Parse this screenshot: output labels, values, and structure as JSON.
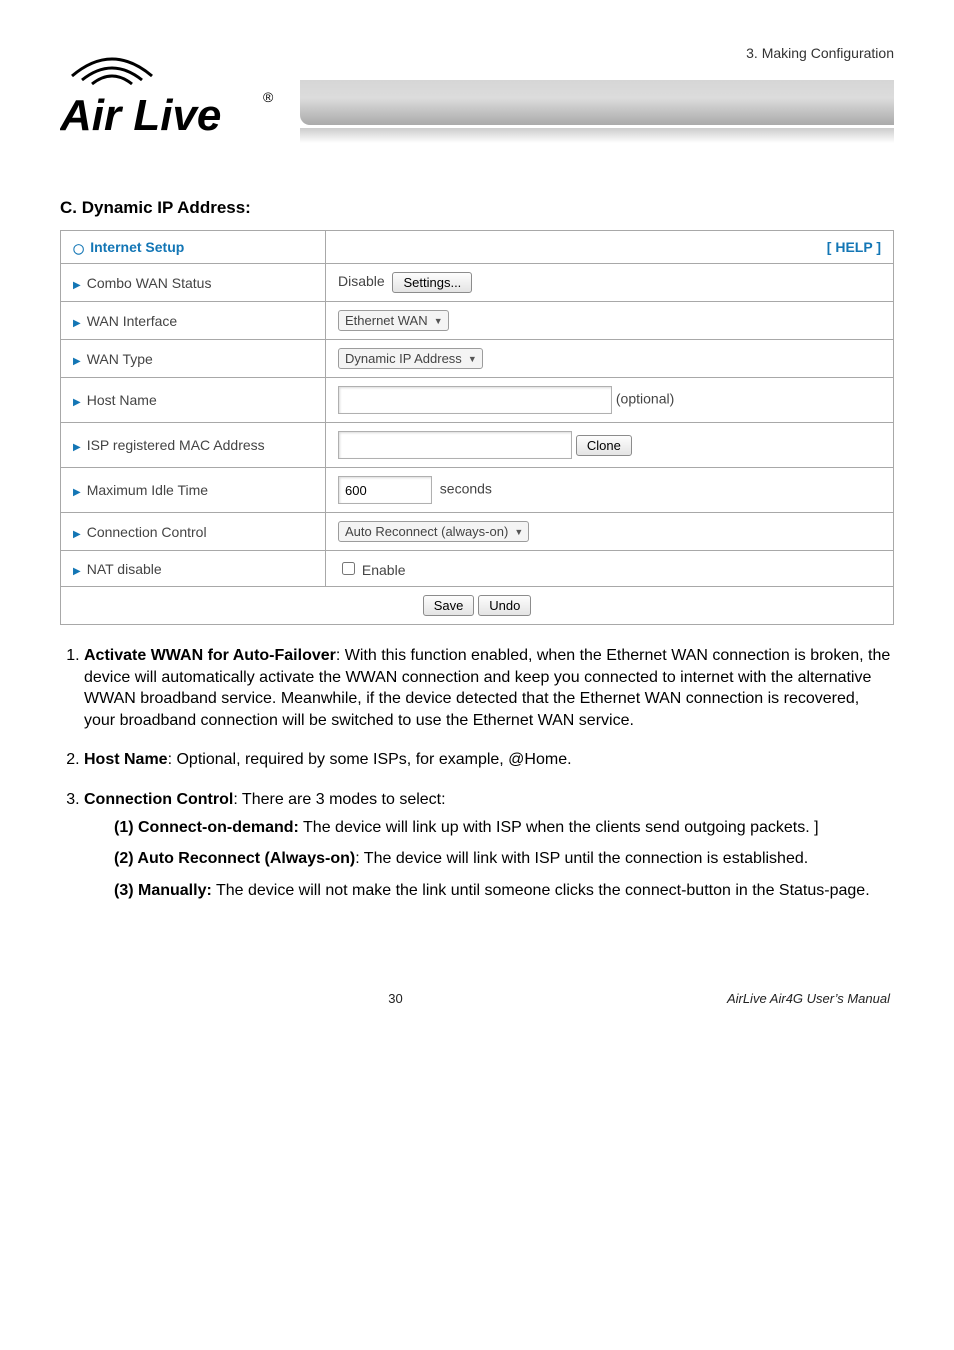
{
  "top_right": "3. Making Configuration",
  "logo": {
    "text_top": "",
    "text_bottom": "Air Live",
    "reg": "®"
  },
  "section_title": "C. Dynamic IP Address:",
  "table": {
    "header": "Internet Setup",
    "help": "[ HELP ]",
    "rows": {
      "combo": {
        "label": "Combo WAN Status",
        "disable": "Disable",
        "settings_btn": "Settings..."
      },
      "wanif": {
        "label": "WAN Interface",
        "value": "Ethernet WAN"
      },
      "wantype": {
        "label": "WAN Type",
        "value": "Dynamic IP Address"
      },
      "host": {
        "label": "Host Name",
        "value": "",
        "hint": "(optional)"
      },
      "isp": {
        "label": "ISP registered MAC Address",
        "value": "",
        "clone_btn": "Clone"
      },
      "idle": {
        "label": "Maximum Idle Time",
        "value": "600",
        "unit": "seconds"
      },
      "conn": {
        "label": "Connection Control",
        "value": "Auto Reconnect (always-on)"
      },
      "nat": {
        "label": "NAT disable",
        "value": "Enable"
      },
      "save": "Save",
      "undo": "Undo"
    }
  },
  "list": {
    "i1": {
      "lead": "Activate WWAN for Auto-Failover",
      "body": ": With this function enabled, when the Ethernet WAN connection is broken, the device will automatically activate the WWAN connection and keep you connected to internet with the alternative WWAN broadband service. Meanwhile, if the device detected that the Ethernet WAN connection is recovered, your broadband connection will be switched to use the Ethernet WAN service."
    },
    "i2": {
      "lead": "Host Name",
      "body": ": Optional, required by some ISPs, for example, @Home."
    },
    "i3": {
      "lead": "Connection Control",
      "body": ": There are 3 modes to select:"
    },
    "s1": {
      "lead": "(1) Connect-on-demand:",
      "body": " The device will link up with ISP when the clients send outgoing packets. ]"
    },
    "s2": {
      "lead": "(2) Auto Reconnect (Always-on)",
      "body": ": The device will link with ISP until the connection is established."
    },
    "s3": {
      "lead": "(3) Manually:",
      "body": " The device will not make the link until someone clicks the connect-button in the Status-page."
    }
  },
  "footer": {
    "page": "30",
    "manual": "AirLive Air4G User’s Manual"
  }
}
